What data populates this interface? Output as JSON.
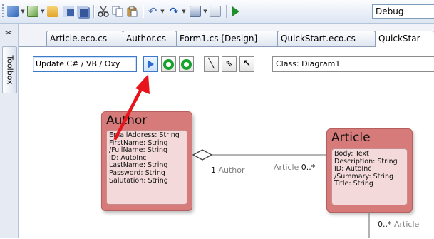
{
  "toolbar": {
    "configuration": "Debug"
  },
  "toolbox": {
    "label": "Toolbox"
  },
  "tabs": [
    {
      "label": "Article.eco.cs"
    },
    {
      "label": "Author.cs"
    },
    {
      "label": "Form1.cs [Design]"
    },
    {
      "label": "QuickStart.eco.cs"
    },
    {
      "label": "QuickStar"
    }
  ],
  "designer_toolbar": {
    "update_label": "Update C# / VB / Oxy",
    "class_label": "Class: Diagram1"
  },
  "classes": {
    "author": {
      "name": "Author",
      "properties": [
        "EmailAddress: String",
        "FirstName: String",
        "/FullName: String",
        "ID: AutoInc",
        "LastName: String",
        "Password: String",
        "Salutation: String"
      ]
    },
    "article": {
      "name": "Article",
      "properties": [
        "Body: Text",
        "Description: String",
        "ID: AutoInc",
        "/Summary: String",
        "Title: String"
      ]
    }
  },
  "associations": {
    "author_end_mult": "1",
    "author_end_role": "Author",
    "article_end_role": "Article",
    "article_end_mult": "0..*",
    "lower_mult": "0..*",
    "lower_role": "Article"
  },
  "colors": {
    "class_fill": "#d77a7a",
    "class_body": "#f3d9d9",
    "arrow": "#e8141b",
    "toolbar_bg": "#dde6f3"
  }
}
